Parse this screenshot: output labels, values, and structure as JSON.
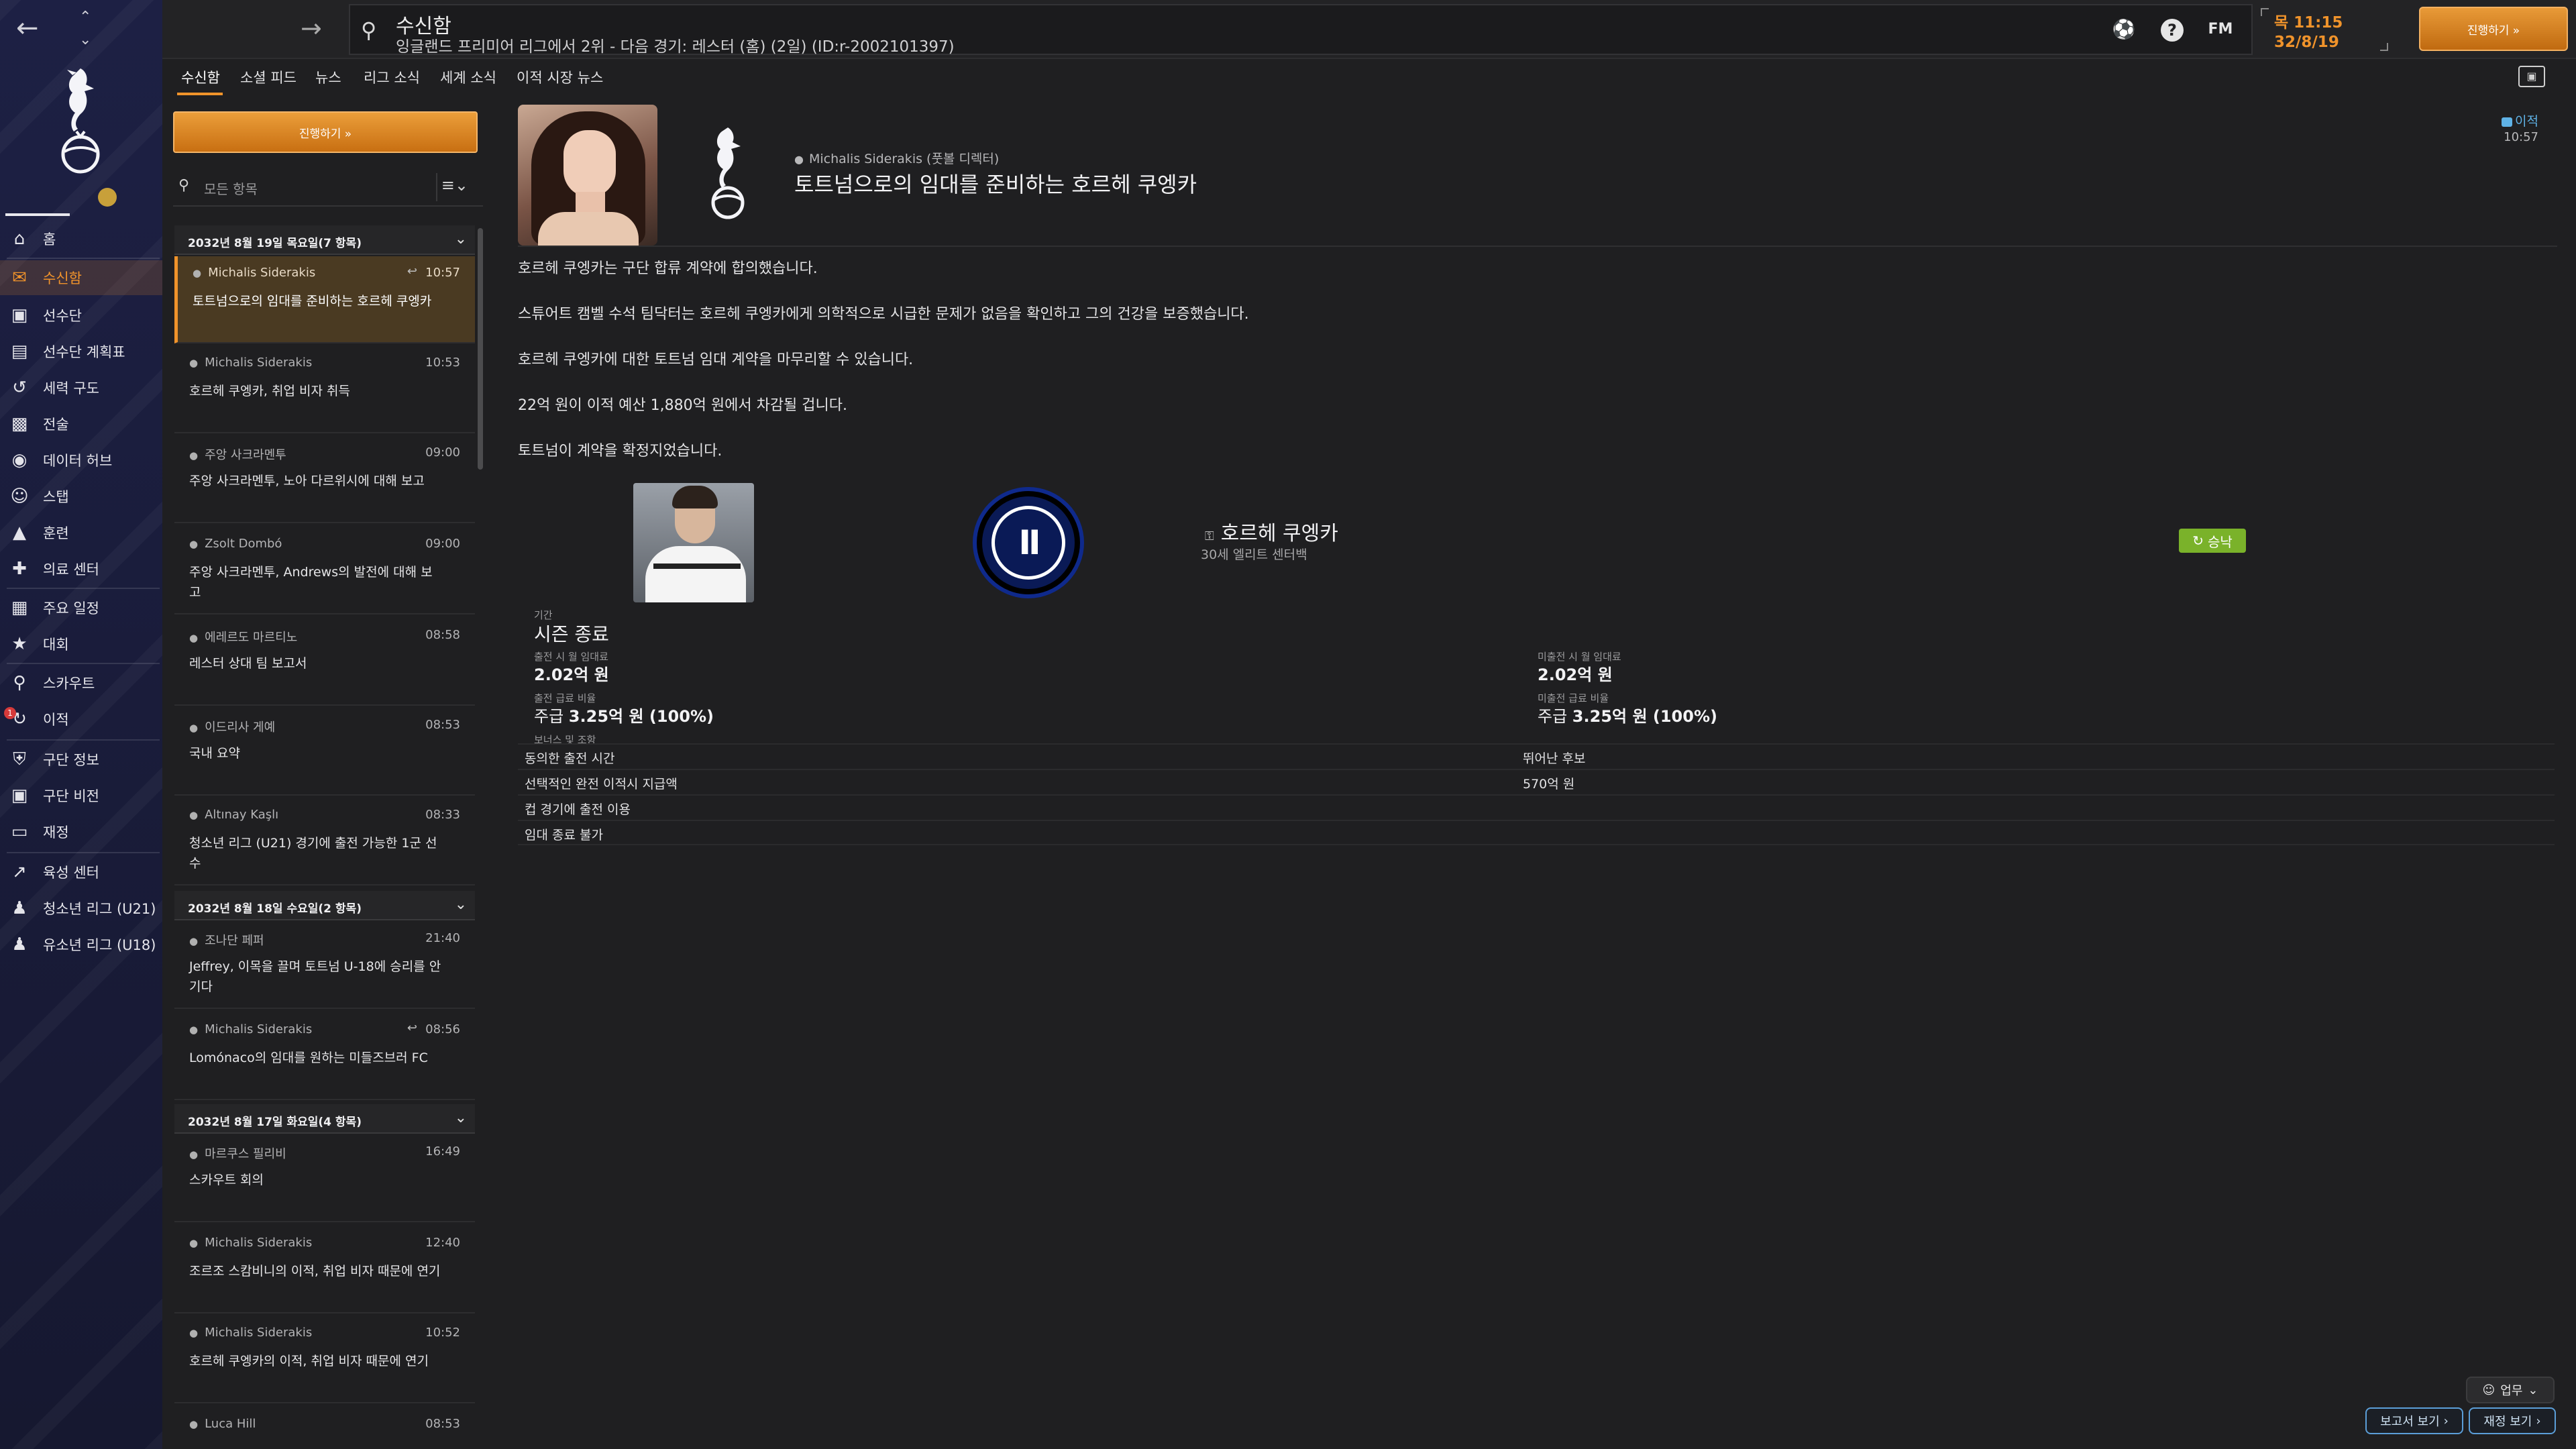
{
  "header": {
    "title": "수신함",
    "subtitle": "잉글랜드 프리미어 리그에서 2위 - 다음 경기: 레스터 (홈) (2일) (ID:r-2002101397)",
    "date_day_time": "목 11:15",
    "date": "32/8/19",
    "fm_label": "FM",
    "help_label": "?",
    "continue_label": "진행하기 »"
  },
  "tabs": [
    {
      "label": "수신함"
    },
    {
      "label": "소셜 피드"
    },
    {
      "label": "뉴스"
    },
    {
      "label": "리그 소식"
    },
    {
      "label": "세계 소식"
    },
    {
      "label": "이적 시장 뉴스"
    }
  ],
  "sidebar": {
    "items": [
      {
        "label": "홈",
        "icon": "home-icon"
      },
      {
        "label": "수신함",
        "icon": "inbox-icon"
      },
      {
        "label": "선수단",
        "icon": "shirt-icon"
      },
      {
        "label": "선수단 계획표",
        "icon": "clipboard-icon"
      },
      {
        "label": "세력 구도",
        "icon": "dynamics-icon"
      },
      {
        "label": "전술",
        "icon": "tactics-icon"
      },
      {
        "label": "데이터 허브",
        "icon": "data-icon"
      },
      {
        "label": "스탭",
        "icon": "staff-icon"
      },
      {
        "label": "훈련",
        "icon": "training-icon"
      },
      {
        "label": "의료 센터",
        "icon": "medical-icon"
      },
      {
        "label": "주요 일정",
        "icon": "calendar-icon"
      },
      {
        "label": "대회",
        "icon": "trophy-icon"
      },
      {
        "label": "스카우트",
        "icon": "scout-icon"
      },
      {
        "label": "이적",
        "icon": "transfer-icon"
      },
      {
        "label": "구단 정보",
        "icon": "club-info-icon"
      },
      {
        "label": "구단 비전",
        "icon": "vision-icon"
      },
      {
        "label": "재정",
        "icon": "finance-icon"
      },
      {
        "label": "육성 센터",
        "icon": "development-icon"
      },
      {
        "label": "청소년 리그 (U21)",
        "icon": "u21-icon"
      },
      {
        "label": "유소년 리그 (U18)",
        "icon": "u18-icon"
      }
    ],
    "transfer_badge": "1"
  },
  "inbox": {
    "continue_label": "진행하기 »",
    "filter_placeholder": "모든 항목",
    "groups": [
      {
        "header": "2032년 8월 19일 목요일(7 항목)",
        "messages": [
          {
            "from": "Michalis Siderakis",
            "time": "10:57",
            "subject": "토트넘으로의 임대를 준비하는 호르헤 쿠엥카",
            "replied": true
          },
          {
            "from": "Michalis Siderakis",
            "time": "10:53",
            "subject": "호르헤 쿠엥카, 취업 비자 취득"
          },
          {
            "from": "주앙 사크라멘투",
            "time": "09:00",
            "subject": "주앙 사크라멘투, 노아 다르위시에 대해 보고"
          },
          {
            "from": "Zsolt Dombó",
            "time": "09:00",
            "subject": "주앙 사크라멘투, Andrews의 발전에 대해 보고"
          },
          {
            "from": "에레르도 마르티노",
            "time": "08:58",
            "subject": "레스터 상대 팀 보고서"
          },
          {
            "from": "이드리사 게예",
            "time": "08:53",
            "subject": "국내 요약"
          },
          {
            "from": "Altınay Kaşlı",
            "time": "08:33",
            "subject": "청소년 리그 (U21) 경기에 출전 가능한 1군 선수"
          }
        ]
      },
      {
        "header": "2032년 8월 18일 수요일(2 항목)",
        "messages": [
          {
            "from": "조나단 페퍼",
            "time": "21:40",
            "subject": "Jeffrey, 이목을 끌며 토트넘 U-18에 승리를 안기다"
          },
          {
            "from": "Michalis Siderakis",
            "time": "08:56",
            "subject": "Lomónaco의 임대를 원하는 미들즈브러 FC",
            "replied": true
          }
        ]
      },
      {
        "header": "2032년 8월 17일 화요일(4 항목)",
        "messages": [
          {
            "from": "마르쿠스 필리비",
            "time": "16:49",
            "subject": "스카우트 회의"
          },
          {
            "from": "Michalis Siderakis",
            "time": "12:40",
            "subject": "조르조 스캄비니의 이적, 취업 비자 때문에 연기"
          },
          {
            "from": "Michalis Siderakis",
            "time": "10:52",
            "subject": "호르헤 쿠엥카의 이적, 취업 비자 때문에 연기"
          },
          {
            "from": "Luca Hill",
            "time": "08:53",
            "subject": ""
          }
        ]
      }
    ]
  },
  "message": {
    "sender": "Michalis Siderakis (풋볼 디렉터)",
    "title": "토트넘으로의 임대를 준비하는 호르헤 쿠엥카",
    "tag": "이적",
    "time": "10:57",
    "body": [
      "호르헤 쿠엥카는 구단 합류 계약에 합의했습니다.",
      "스튜어트 캠벨 수석 팀닥터는 호르헤 쿠엥카에게 의학적으로 시급한 문제가 없음을 확인하고 그의 건강을 보증했습니다.",
      "호르헤 쿠엥카에 대한 토트넘 임대 계약을 마무리할 수 있습니다.",
      "22억 원이 이적 예산 1,880억 원에서 차감될 겁니다.",
      "토트넘이 계약을 확정지었습니다."
    ]
  },
  "deal": {
    "player_name": "호르헤 쿠엥카",
    "player_desc": "30세 엘리트 센터백",
    "status": "승낙",
    "period_label": "기간",
    "period_value": "시즌 종료",
    "fee_played_label": "출전 시 월 임대료",
    "fee_played_value": "2.02억 원",
    "fee_unplayed_label": "미출전 시 월 임대료",
    "fee_unplayed_value": "2.02억 원",
    "wage_played_label": "출전 급료 비율",
    "wage_played_value_prefix": "주급 ",
    "wage_played_value": "3.25억 원 (100%)",
    "wage_unplayed_label": "미출전 급료 비율",
    "wage_unplayed_value_prefix": "주급 ",
    "wage_unplayed_value": "3.25억 원 (100%)",
    "clauses_label": "보너스 및 조항",
    "clauses": [
      {
        "a": "동의한 출전 시간",
        "b": "뛰어난 후보"
      },
      {
        "a": "선택적인 완전 이적시 지급액",
        "b": "570억 원"
      },
      {
        "a": "컵 경기에 출전 이용",
        "b": ""
      },
      {
        "a": "임대 종료 불가",
        "b": ""
      }
    ]
  },
  "footer": {
    "task_label": "업무",
    "report_label": "보고서 보기",
    "finance_label": "재정 보기"
  }
}
